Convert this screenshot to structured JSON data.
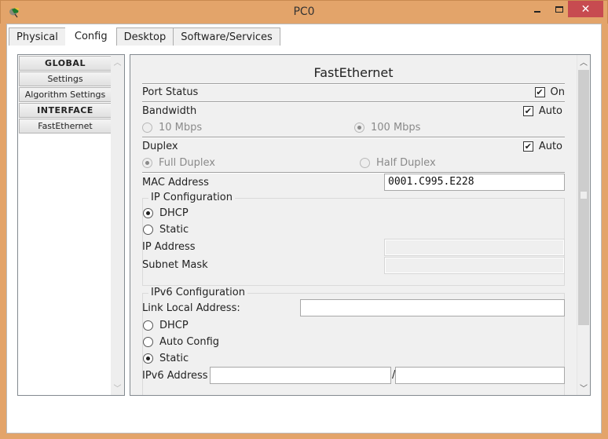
{
  "window": {
    "title": "PC0",
    "icon": "packet-tracer-pc-icon",
    "controls": {
      "minimize": "minimize-icon",
      "maximize": "maximize-icon",
      "close": "✕"
    }
  },
  "tabs": [
    {
      "label": "Physical",
      "active": false
    },
    {
      "label": "Config",
      "active": true
    },
    {
      "label": "Desktop",
      "active": false
    },
    {
      "label": "Software/Services",
      "active": false
    }
  ],
  "sidebar": {
    "items": [
      {
        "label": "GLOBAL",
        "type": "header"
      },
      {
        "label": "Settings",
        "type": "item"
      },
      {
        "label": "Algorithm Settings",
        "type": "item"
      },
      {
        "label": "INTERFACE",
        "type": "header"
      },
      {
        "label": "FastEthernet",
        "type": "item"
      }
    ],
    "scroll_up": "^",
    "scroll_down": "v"
  },
  "main": {
    "heading": "FastEthernet",
    "port_status": {
      "label": "Port Status",
      "checkbox_label": "On",
      "checked": true
    },
    "bandwidth": {
      "label": "Bandwidth",
      "auto_label": "Auto",
      "auto_checked": true,
      "options": [
        {
          "label": "10 Mbps",
          "selected": false
        },
        {
          "label": "100 Mbps",
          "selected": true
        }
      ]
    },
    "duplex": {
      "label": "Duplex",
      "auto_label": "Auto",
      "auto_checked": true,
      "options": [
        {
          "label": "Full Duplex",
          "selected": true
        },
        {
          "label": "Half Duplex",
          "selected": false
        }
      ]
    },
    "mac": {
      "label": "MAC Address",
      "value": "0001.C995.E228"
    },
    "ip_config": {
      "legend": "IP Configuration",
      "options": [
        {
          "label": "DHCP",
          "selected": true
        },
        {
          "label": "Static",
          "selected": false
        }
      ],
      "ip_label": "IP Address",
      "ip_value": "",
      "mask_label": "Subnet Mask",
      "mask_value": ""
    },
    "ipv6_config": {
      "legend": "IPv6 Configuration",
      "link_local_label": "Link Local Address:",
      "link_local_value": "",
      "options": [
        {
          "label": "DHCP",
          "selected": false
        },
        {
          "label": "Auto Config",
          "selected": false
        },
        {
          "label": "Static",
          "selected": true
        }
      ],
      "address_label": "IPv6 Address",
      "address_value": "",
      "prefix_separator": "/",
      "prefix_value": ""
    },
    "check_mark": "✔"
  }
}
